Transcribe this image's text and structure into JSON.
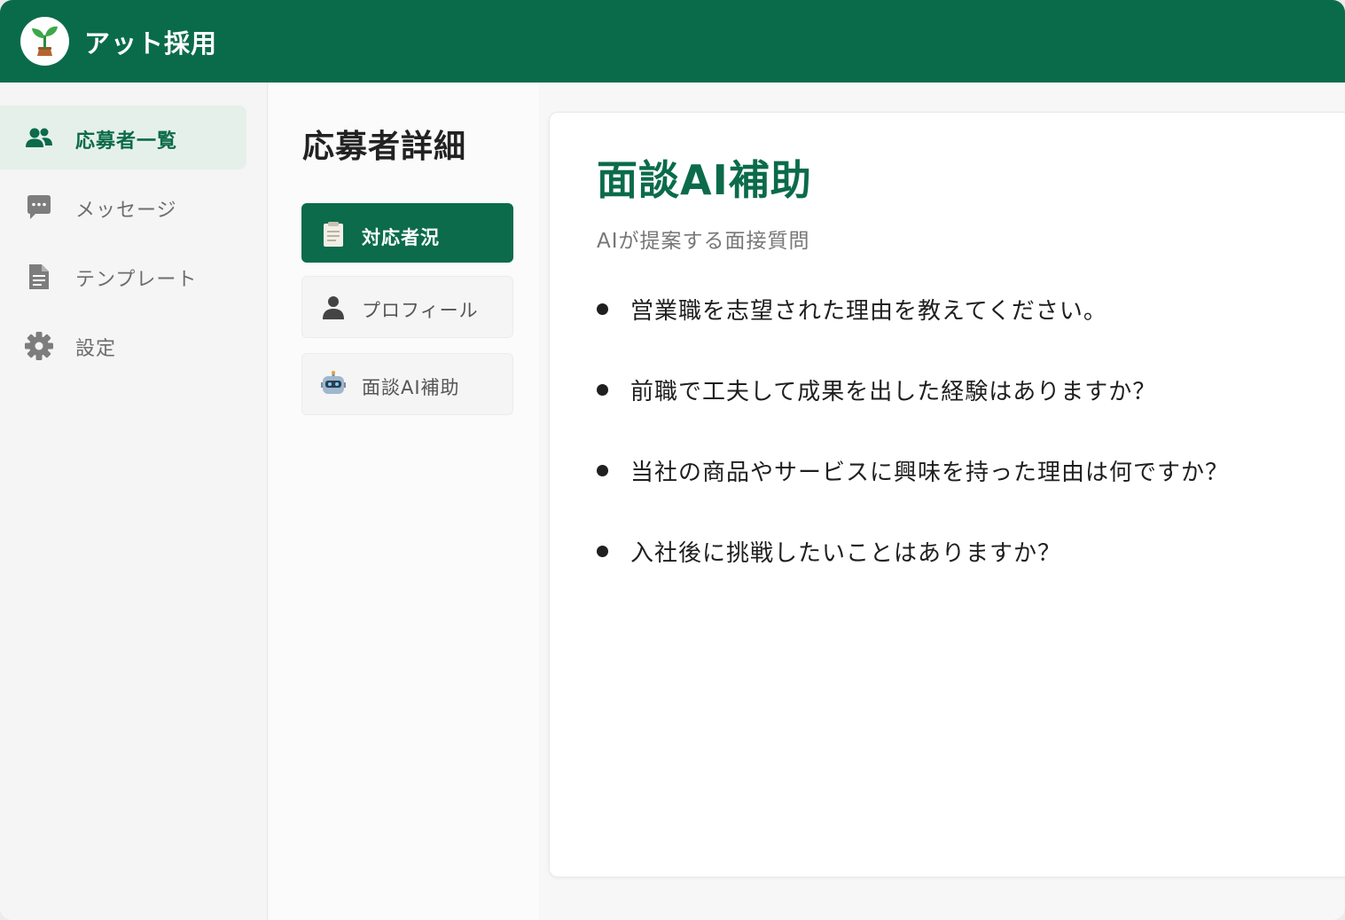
{
  "header": {
    "app_name": "アット採用",
    "logo_icon": "sprout-icon",
    "background": "#0a6b4b"
  },
  "sidebar": {
    "items": [
      {
        "label": "応募者一覧",
        "icon": "users-icon",
        "active": true
      },
      {
        "label": "メッセージ",
        "icon": "chat-bubble-icon",
        "active": false
      },
      {
        "label": "テンプレート",
        "icon": "document-icon",
        "active": false
      },
      {
        "label": "設定",
        "icon": "gear-icon",
        "active": false
      }
    ]
  },
  "detail": {
    "title": "応募者詳細",
    "tabs": [
      {
        "label": "対応者況",
        "icon": "clipboard-icon",
        "active": true
      },
      {
        "label": "プロフィール",
        "icon": "person-icon",
        "active": false
      },
      {
        "label": "面談AI補助",
        "icon": "robot-icon",
        "active": false
      }
    ]
  },
  "panel": {
    "title": "面談AI補助",
    "subtitle": "AIが提案する面接質問",
    "questions": [
      "営業職を志望された理由を教えてください。",
      "前職で工夫して成果を出した経験はありますか？",
      "当社の商品やサービスに興味を持った理由は何ですか？",
      "入社後に挑戦したいことはありますか？"
    ]
  },
  "colors": {
    "brand_green": "#0b6b4b",
    "active_nav_bg": "#e6f0ea"
  }
}
